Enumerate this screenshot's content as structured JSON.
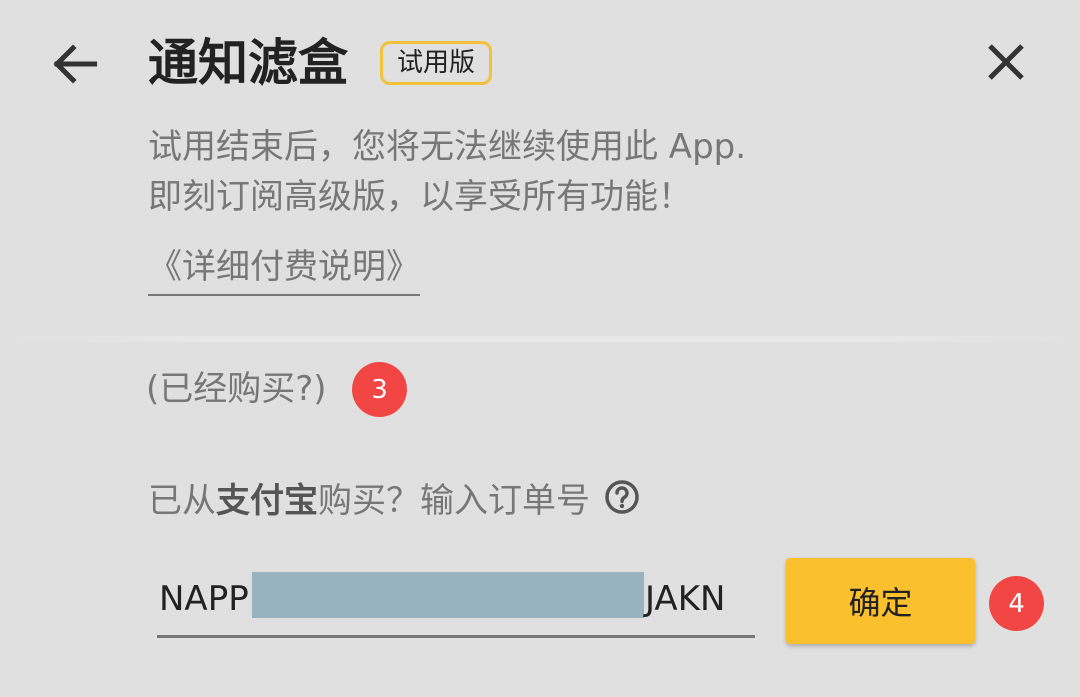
{
  "header": {
    "back_icon": "arrow-left-icon",
    "title": "通知滤盒",
    "badge": "试用版",
    "close_icon": "close-icon"
  },
  "description": {
    "line1": "试用结束后，您将无法继续使用此 App.",
    "line2": "即刻订阅高级版，以享受所有功能！"
  },
  "details_link": "《详细付费说明》",
  "already_bought": {
    "label": "(已经购买?)",
    "marker": "3"
  },
  "alipay": {
    "prefix": "已从",
    "brand": "支付宝",
    "suffix": "购买？输入订单号",
    "help_icon": "help-circle-icon"
  },
  "order_input": {
    "prefix": "NAPP",
    "suffix": "JAKN"
  },
  "confirm": {
    "label": "确定",
    "marker": "4"
  },
  "colors": {
    "accent": "#fbc02d",
    "badge_border": "#f2c23a",
    "marker": "#f14644",
    "background": "#e0e0e0",
    "masked": "#98b2c0"
  }
}
